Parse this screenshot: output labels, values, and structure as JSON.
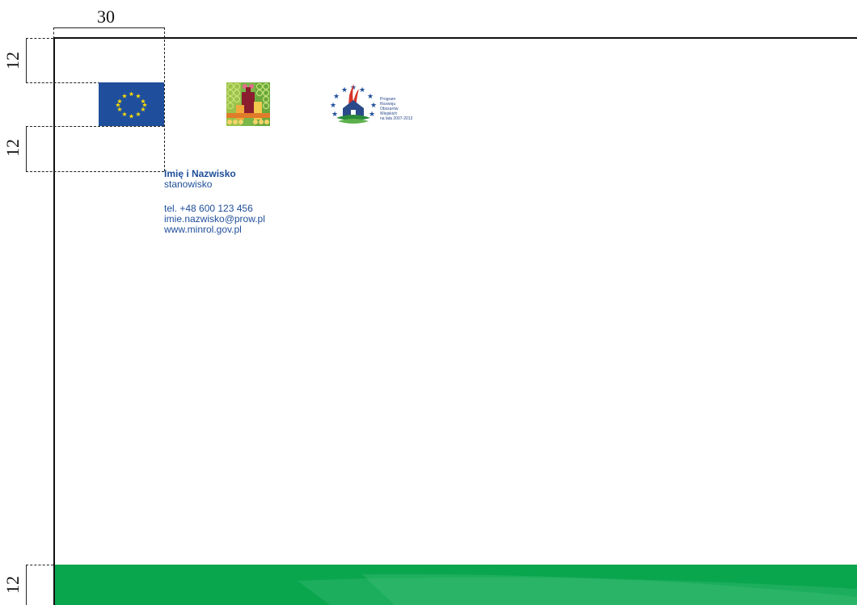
{
  "dimensions": {
    "top_width": "30",
    "top_margin": "12",
    "mid_margin": "12",
    "bottom_margin": "12"
  },
  "logos": {
    "eu_flag": "eu-flag-icon",
    "leader": "leader-logo-icon",
    "prow": "prow-logo-icon",
    "prow_lines": [
      "Program",
      "Rozwoju",
      "Obszarów",
      "Wiejskich",
      "na lata 2007-2013"
    ]
  },
  "contact": {
    "name": "Imię i Nazwisko",
    "role": "stanowisko",
    "phone": "tel. +48 600 123 456",
    "email": "imie.nazwisko@prow.pl",
    "website": "www.minrol.gov.pl"
  },
  "colors": {
    "brand_blue": "#1f4e9a",
    "footer_green": "#0aa64e",
    "eu_blue": "#1f4f9c",
    "eu_star": "#ffdd00"
  }
}
